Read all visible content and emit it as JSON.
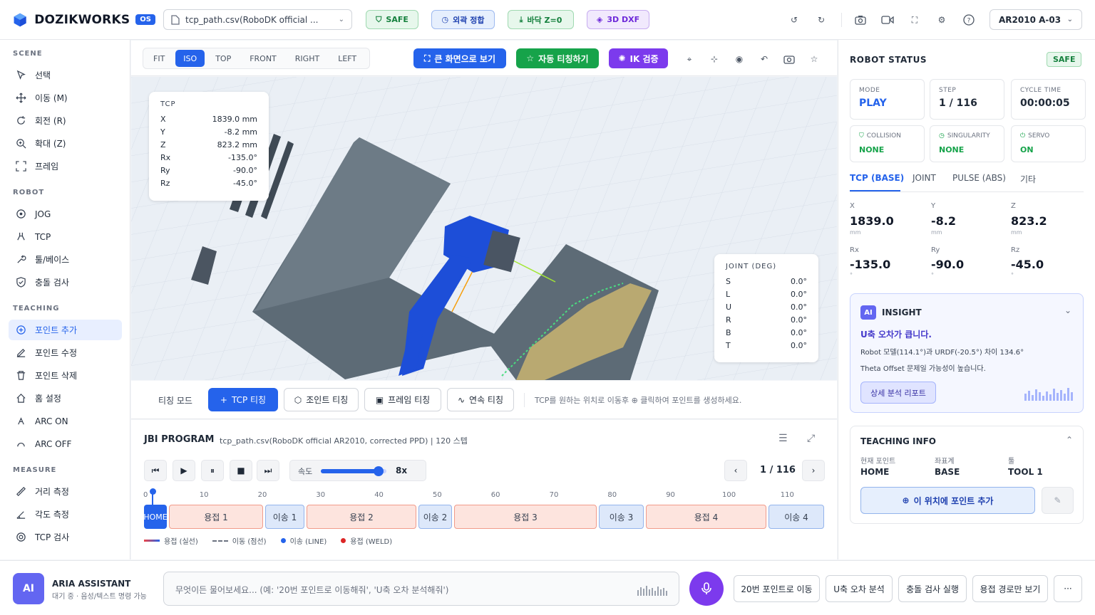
{
  "header": {
    "brand": "DOZIKWORKS",
    "version": "OS",
    "file": "tcp_path.csv(RoboDK official ...",
    "pills": [
      "SAFE",
      "외곽 정합",
      "바닥 Z=0",
      "3D DXF"
    ],
    "robot": "AR2010 A-03"
  },
  "sidebar": {
    "sections": [
      "SCENE",
      "ROBOT",
      "TEACHING",
      "MEASURE"
    ],
    "scene": [
      "선택",
      "이동 (M)",
      "회전 (R)",
      "확대 (Z)",
      "프레임"
    ],
    "robot": [
      "JOG",
      "TCP",
      "툴/베이스",
      "충돌 검사"
    ],
    "teaching": [
      "포인트 추가",
      "포인트 수정",
      "포인트 삭제",
      "홈 설정",
      "ARC ON",
      "ARC OFF"
    ],
    "measure": [
      "거리 측정",
      "각도 측정",
      "TCP 검사"
    ]
  },
  "viewbar": {
    "tabs": [
      "FIT",
      "ISO",
      "TOP",
      "FRONT",
      "RIGHT",
      "LEFT"
    ],
    "active_tab": "ISO",
    "fullscreen": "큰 화면으로 보기",
    "auto_teach": "자동 티칭하기",
    "ik": "IK 검증"
  },
  "tcp": {
    "title": "TCP",
    "rows": [
      {
        "k": "X",
        "v": "1839.0 mm"
      },
      {
        "k": "Y",
        "v": "-8.2 mm"
      },
      {
        "k": "Z",
        "v": "823.2 mm"
      },
      {
        "k": "Rx",
        "v": "-135.0°"
      },
      {
        "k": "Ry",
        "v": "-90.0°"
      },
      {
        "k": "Rz",
        "v": "-45.0°"
      }
    ]
  },
  "joint": {
    "title": "JOINT (DEG)",
    "rows": [
      {
        "k": "S",
        "v": "0.0°"
      },
      {
        "k": "L",
        "v": "0.0°"
      },
      {
        "k": "U",
        "v": "0.0°"
      },
      {
        "k": "R",
        "v": "0.0°"
      },
      {
        "k": "B",
        "v": "0.0°"
      },
      {
        "k": "T",
        "v": "0.0°"
      }
    ]
  },
  "teach": {
    "mode_label": "티칭 모드",
    "buttons": [
      "TCP 티칭",
      "조인트 티칭",
      "프레임 티칭",
      "연속 티칭"
    ],
    "hint": "TCP를 원하는 위치로 이동후 ⊕ 클릭하여 포인트를 생성하세요."
  },
  "program": {
    "title": "JBI PROGRAM",
    "subtitle": "tcp_path.csv(RoboDK official AR2010, corrected PPD) | 120 스텝",
    "speed_label": "속도",
    "speed_value": "8x",
    "speed_fraction": 0.88,
    "step": "1 / 116",
    "ticks": [
      "0",
      "10",
      "20",
      "30",
      "40",
      "50",
      "60",
      "70",
      "80",
      "90",
      "100",
      "110"
    ],
    "segments": [
      "HOME",
      "용접 1",
      "이송 1",
      "용접 2",
      "이송 2",
      "용접 3",
      "이송 3",
      "용접 4",
      "이송 4"
    ],
    "legend": [
      "용접 (실선)",
      "이동 (점선)",
      "이송 (LINE)",
      "용접 (WELD)"
    ]
  },
  "status": {
    "title": "ROBOT STATUS",
    "badge": "SAFE",
    "mode_label": "MODE",
    "mode": "PLAY",
    "step_label": "STEP",
    "step": "1 / 116",
    "cycle_label": "CYCLE TIME",
    "cycle": "00:00:05",
    "collision_label": "COLLISION",
    "collision": "NONE",
    "singularity_label": "SINGULARITY",
    "singularity": "NONE",
    "servo_label": "SERVO",
    "servo": "ON",
    "tabs": [
      "TCP (BASE)",
      "JOINT",
      "PULSE (ABS)",
      "기타"
    ],
    "coords": [
      {
        "k": "X",
        "v": "1839.0",
        "u": "mm"
      },
      {
        "k": "Y",
        "v": "-8.2",
        "u": "mm"
      },
      {
        "k": "Z",
        "v": "823.2",
        "u": "mm"
      },
      {
        "k": "Rx",
        "v": "-135.0",
        "u": "°"
      },
      {
        "k": "Ry",
        "v": "-90.0",
        "u": "°"
      },
      {
        "k": "Rz",
        "v": "-45.0",
        "u": "°"
      }
    ]
  },
  "insight": {
    "badge": "AI",
    "title": "INSIGHT",
    "headline": "U축 오차가 큽니다.",
    "line1": "Robot 모델(114.1°)과 URDF(-20.5°) 차이 134.6°",
    "line2": "Theta Offset 문제일 가능성이 높습니다.",
    "button": "상세 분석 리포트"
  },
  "teaching_info": {
    "title": "TEACHING INFO",
    "current_label": "현재 포인트",
    "current": "HOME",
    "frame_label": "좌표계",
    "frame": "BASE",
    "tool_label": "툴",
    "tool": "TOOL 1",
    "add_button": "이 위치에 포인트 추가"
  },
  "assistant": {
    "badge": "AI",
    "name": "ARIA ASSISTANT",
    "status": "대기 중 · 음성/텍스트 명령 가능",
    "placeholder": "무엇이든 물어보세요... (예: '20번 포인트로 이동해줘', 'U축 오차 분석해줘')",
    "quick": [
      "20번 포인트로 이동",
      "U축 오차 분석",
      "충돌 검사 실행",
      "용접 경로만 보기"
    ],
    "more": "···"
  }
}
